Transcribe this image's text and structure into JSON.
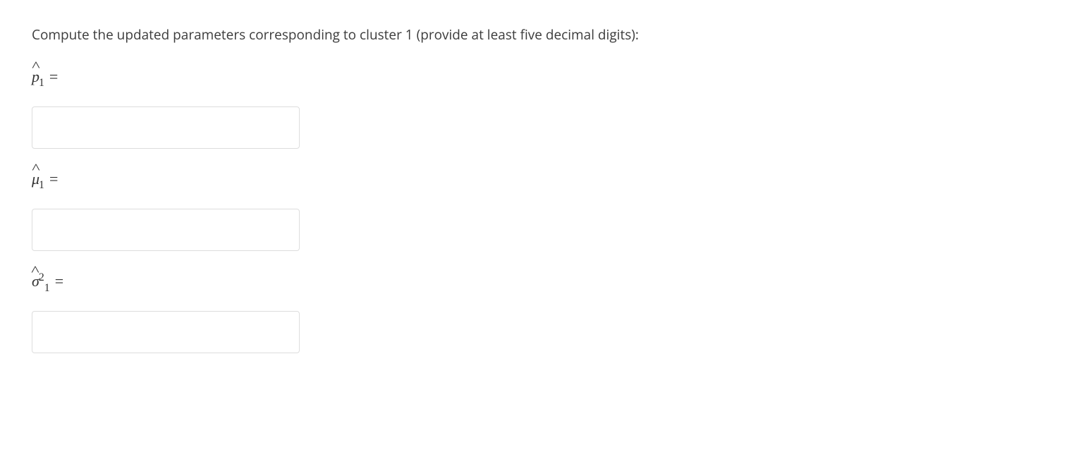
{
  "prompt": "Compute the updated parameters corresponding to cluster 1 (provide at least five decimal digits):",
  "fields": {
    "p1": {
      "value": ""
    },
    "mu1": {
      "value": ""
    },
    "sigma1": {
      "value": ""
    }
  }
}
